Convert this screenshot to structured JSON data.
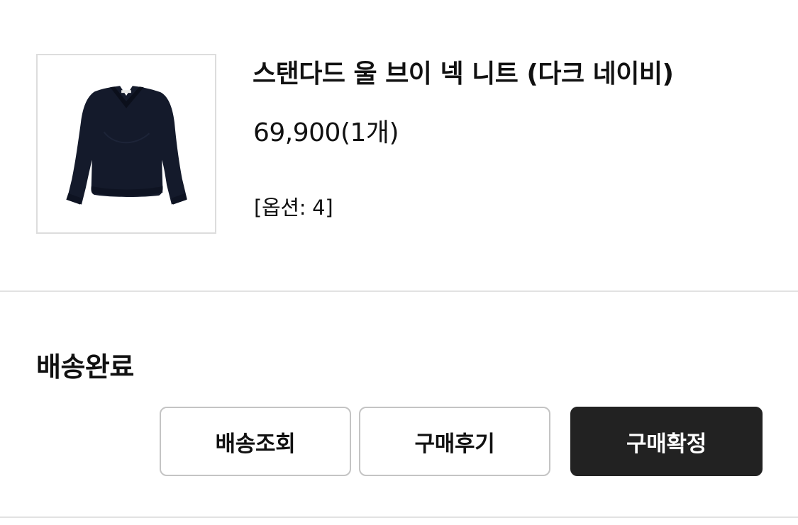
{
  "product": {
    "name": "스탠다드 울 브이 넥 니트 (다크 네이비)",
    "price": "69,900(1개)",
    "option": "[옵션: 4]",
    "image_icon": "navy-v-neck-sweater-image"
  },
  "order": {
    "status": "배송완료"
  },
  "actions": {
    "track_label": "배송조회",
    "review_label": "구매후기",
    "confirm_label": "구매확정"
  },
  "colors": {
    "sweater": "#141a2b",
    "button_dark": "#222222",
    "button_border": "#c4c4c4",
    "divider": "#e2e2e2"
  }
}
